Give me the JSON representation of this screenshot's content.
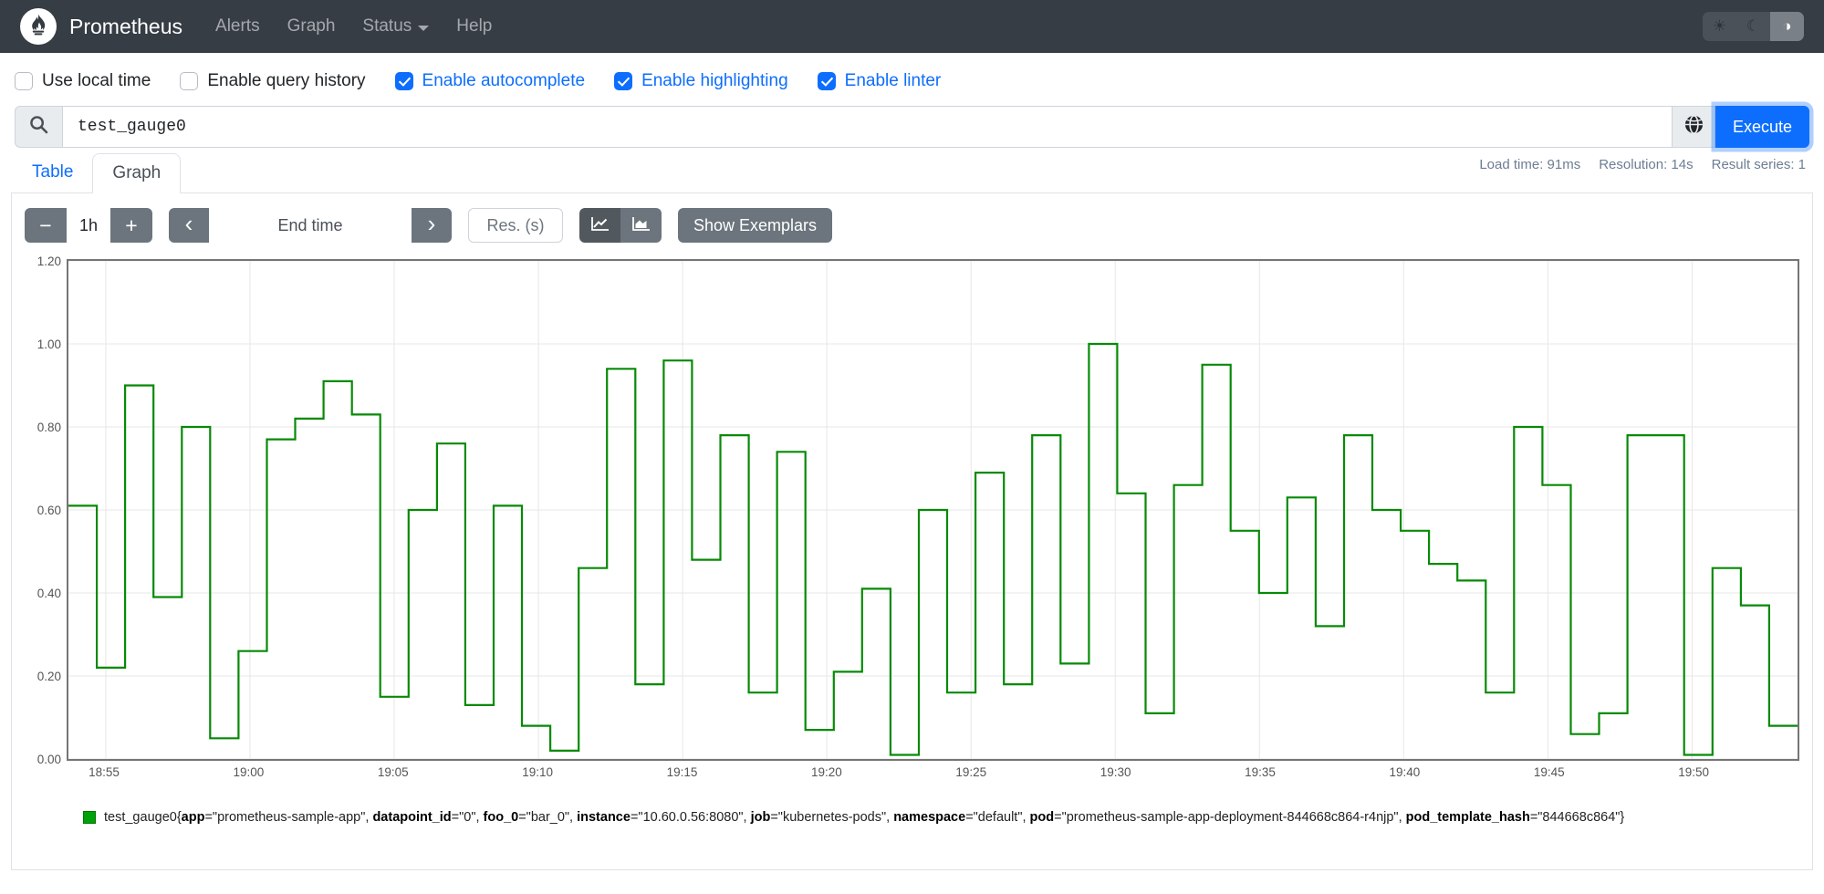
{
  "navbar": {
    "brand": "Prometheus",
    "links": [
      {
        "label": "Alerts"
      },
      {
        "label": "Graph"
      },
      {
        "label": "Status",
        "caret": true
      },
      {
        "label": "Help"
      }
    ],
    "theme_toggle": {
      "options": [
        "light",
        "dark",
        "auto"
      ],
      "active": "auto"
    }
  },
  "options_bar": {
    "checkboxes": [
      {
        "label": "Use local time",
        "checked": false
      },
      {
        "label": "Enable query history",
        "checked": false
      },
      {
        "label": "Enable autocomplete",
        "checked": true
      },
      {
        "label": "Enable highlighting",
        "checked": true
      },
      {
        "label": "Enable linter",
        "checked": true
      }
    ]
  },
  "query_bar": {
    "value": "test_gauge0",
    "execute_label": "Execute"
  },
  "stats": {
    "load_time": "Load time: 91ms",
    "resolution": "Resolution: 14s",
    "result_series": "Result series: 1"
  },
  "tabs": [
    {
      "label": "Table",
      "active": false
    },
    {
      "label": "Graph",
      "active": true
    }
  ],
  "graph_controls": {
    "decrease_label": "−",
    "range_value": "1h",
    "increase_label": "+",
    "prev_label": "‹",
    "end_time_placeholder": "End time",
    "next_label": "›",
    "resolution_placeholder": "Res. (s)",
    "show_exemplars_label": "Show Exemplars"
  },
  "chart_data": {
    "type": "line",
    "style": "step",
    "title": "",
    "xlabel": "",
    "ylabel": "",
    "ylim": [
      0,
      1.2
    ],
    "y_ticks": [
      "0.00",
      "0.20",
      "0.40",
      "0.60",
      "0.80",
      "1.00",
      "1.20"
    ],
    "x_ticks": [
      "18:55",
      "19:00",
      "19:05",
      "19:10",
      "19:15",
      "19:20",
      "19:25",
      "19:30",
      "19:35",
      "19:40",
      "19:45",
      "19:50"
    ],
    "x_range": [
      "18:53",
      "19:53"
    ],
    "x_tick_start_fraction": 0.0216,
    "x_tick_step_fraction": 0.0834,
    "grid": true,
    "line_color": "#078a07",
    "series": [
      {
        "name": "test_gauge0",
        "values": [
          0.61,
          0.22,
          0.9,
          0.39,
          0.8,
          0.05,
          0.26,
          0.77,
          0.82,
          0.91,
          0.83,
          0.15,
          0.6,
          0.76,
          0.13,
          0.61,
          0.08,
          0.02,
          0.46,
          0.94,
          0.18,
          0.96,
          0.48,
          0.78,
          0.16,
          0.74,
          0.07,
          0.21,
          0.41,
          0.01,
          0.6,
          0.16,
          0.69,
          0.18,
          0.78,
          0.23,
          1.0,
          0.64,
          0.11,
          0.66,
          0.95,
          0.55,
          0.4,
          0.63,
          0.32,
          0.78,
          0.6,
          0.55,
          0.47,
          0.43,
          0.16,
          0.8,
          0.66,
          0.06,
          0.11,
          0.78,
          0.78,
          0.01,
          0.46,
          0.37,
          0.08
        ]
      }
    ]
  },
  "legend": {
    "metric": "test_gauge0",
    "labels": [
      {
        "key": "app",
        "value": "prometheus-sample-app"
      },
      {
        "key": "datapoint_id",
        "value": "0"
      },
      {
        "key": "foo_0",
        "value": "bar_0"
      },
      {
        "key": "instance",
        "value": "10.60.0.56:8080"
      },
      {
        "key": "job",
        "value": "kubernetes-pods"
      },
      {
        "key": "namespace",
        "value": "default"
      },
      {
        "key": "pod",
        "value": "prometheus-sample-app-deployment-844668c864-r4njp"
      },
      {
        "key": "pod_template_hash",
        "value": "844668c864"
      }
    ]
  }
}
